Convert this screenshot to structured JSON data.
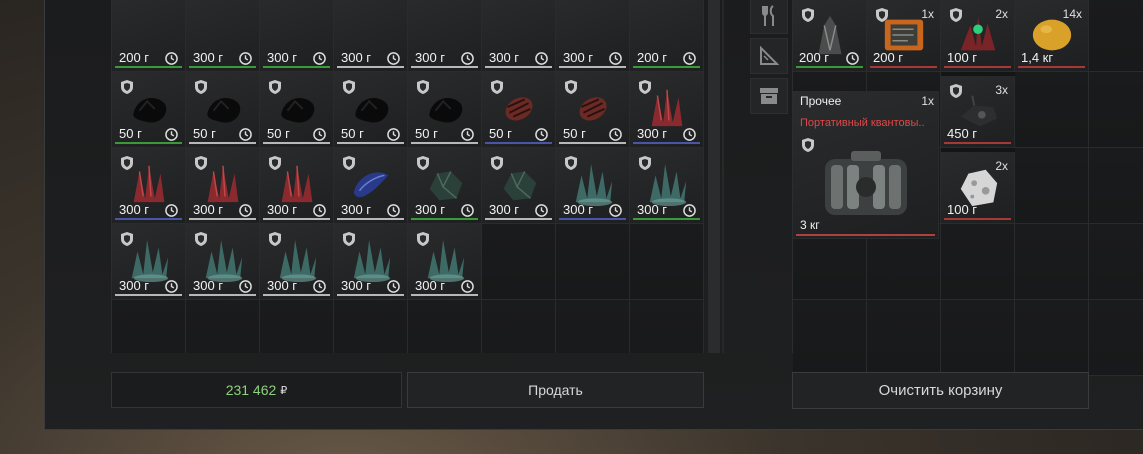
{
  "colors": {
    "rarity_green": "#3a9a3a",
    "rarity_blue": "#4a55a8",
    "rarity_red": "#a83838",
    "rarity_white": "#b8b8b8",
    "money": "#8ed27e",
    "alert": "#e04848"
  },
  "inventory": {
    "items": [
      {
        "price": "200 г",
        "art": "none",
        "rarity": "green"
      },
      {
        "price": "300 г",
        "art": "none",
        "rarity": "green"
      },
      {
        "price": "300 г",
        "art": "none",
        "rarity": "green"
      },
      {
        "price": "300 г",
        "art": "none",
        "rarity": "white"
      },
      {
        "price": "300 г",
        "art": "none",
        "rarity": "white"
      },
      {
        "price": "300 г",
        "art": "none",
        "rarity": "white"
      },
      {
        "price": "300 г",
        "art": "none",
        "rarity": "white"
      },
      {
        "price": "200 г",
        "art": "none",
        "rarity": "green"
      },
      {
        "price": "50 г",
        "art": "black-crystal",
        "rarity": "green"
      },
      {
        "price": "50 г",
        "art": "black-crystal",
        "rarity": "white"
      },
      {
        "price": "50 г",
        "art": "black-crystal",
        "rarity": "white"
      },
      {
        "price": "50 г",
        "art": "black-crystal",
        "rarity": "white"
      },
      {
        "price": "50 г",
        "art": "black-crystal",
        "rarity": "white"
      },
      {
        "price": "50 г",
        "art": "red-cocoon",
        "rarity": "blue"
      },
      {
        "price": "50 г",
        "art": "red-cocoon",
        "rarity": "white"
      },
      {
        "price": "300 г",
        "art": "red-crystal",
        "rarity": "blue"
      },
      {
        "price": "300 г",
        "art": "red-crystal",
        "rarity": "blue"
      },
      {
        "price": "300 г",
        "art": "red-crystal",
        "rarity": "white"
      },
      {
        "price": "300 г",
        "art": "red-crystal",
        "rarity": "white"
      },
      {
        "price": "300 г",
        "art": "blue-shell",
        "rarity": "white"
      },
      {
        "price": "300 г",
        "art": "green-rock",
        "rarity": "green"
      },
      {
        "price": "300 г",
        "art": "green-rock",
        "rarity": "white"
      },
      {
        "price": "300 г",
        "art": "teal-crystal",
        "rarity": "blue"
      },
      {
        "price": "300 г",
        "art": "teal-crystal",
        "rarity": "green"
      },
      {
        "price": "300 г",
        "art": "teal-crystal",
        "rarity": "white"
      },
      {
        "price": "300 г",
        "art": "teal-crystal",
        "rarity": "white"
      },
      {
        "price": "300 г",
        "art": "teal-crystal",
        "rarity": "white"
      },
      {
        "price": "300 г",
        "art": "teal-crystal",
        "rarity": "white"
      },
      {
        "price": "300 г",
        "art": "teal-crystal",
        "rarity": "white"
      }
    ],
    "total_cells": 40
  },
  "side_filters": [
    {
      "icon": "cutlery-icon"
    },
    {
      "icon": "ruler-icon"
    },
    {
      "icon": "box-icon"
    }
  ],
  "basket": {
    "items": [
      {
        "qty": "",
        "price": "200 г",
        "art": "gray-crystal",
        "rarity": "green",
        "clock": true
      },
      {
        "qty": "1x",
        "price": "200 г",
        "art": "orange-device",
        "rarity": "red",
        "clock": false
      },
      {
        "qty": "2x",
        "price": "100 г",
        "art": "red-plant",
        "rarity": "red",
        "clock": false
      },
      {
        "qty": "14x",
        "price": "1,4 кг",
        "art": "lemon",
        "rarity": "red",
        "clock": false
      }
    ],
    "big_item": {
      "category": "Прочее",
      "qty": "1x",
      "name": "Портативный квантовы..",
      "weight": "3 кг"
    },
    "small_right": [
      {
        "qty": "3x",
        "price": "450 г",
        "art": "dark-gadget"
      },
      {
        "qty": "2x",
        "price": "100 г",
        "art": "white-rock"
      }
    ]
  },
  "footer": {
    "money": "231 462",
    "currency": "₽",
    "sell_label": "Продать",
    "clear_label": "Очистить корзину"
  }
}
